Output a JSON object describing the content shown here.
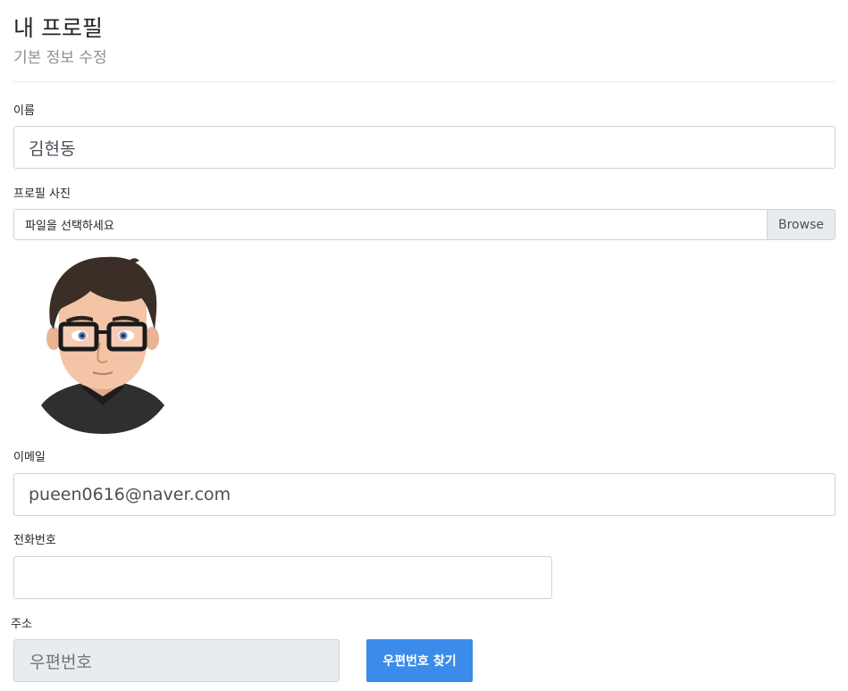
{
  "header": {
    "title": "내 프로필",
    "subtitle": "기본 정보 수정"
  },
  "form": {
    "name_label": "이름",
    "name_value": "김현동",
    "photo_label": "프로필 사진",
    "file_placeholder": "파일을 선택하세요",
    "browse_label": "Browse",
    "email_label": "이메일",
    "email_value": "pueen0616@naver.com",
    "phone_label": "전화번호",
    "phone_value": "",
    "address_label": "주소",
    "zip_placeholder": "우편번호",
    "zip_button_label": "우편번호 찾기"
  },
  "colors": {
    "primary_button": "#3b8beb",
    "readonly_background": "#e9ecef"
  },
  "icons": {
    "avatar": "cartoon-man-with-glasses-avatar"
  }
}
